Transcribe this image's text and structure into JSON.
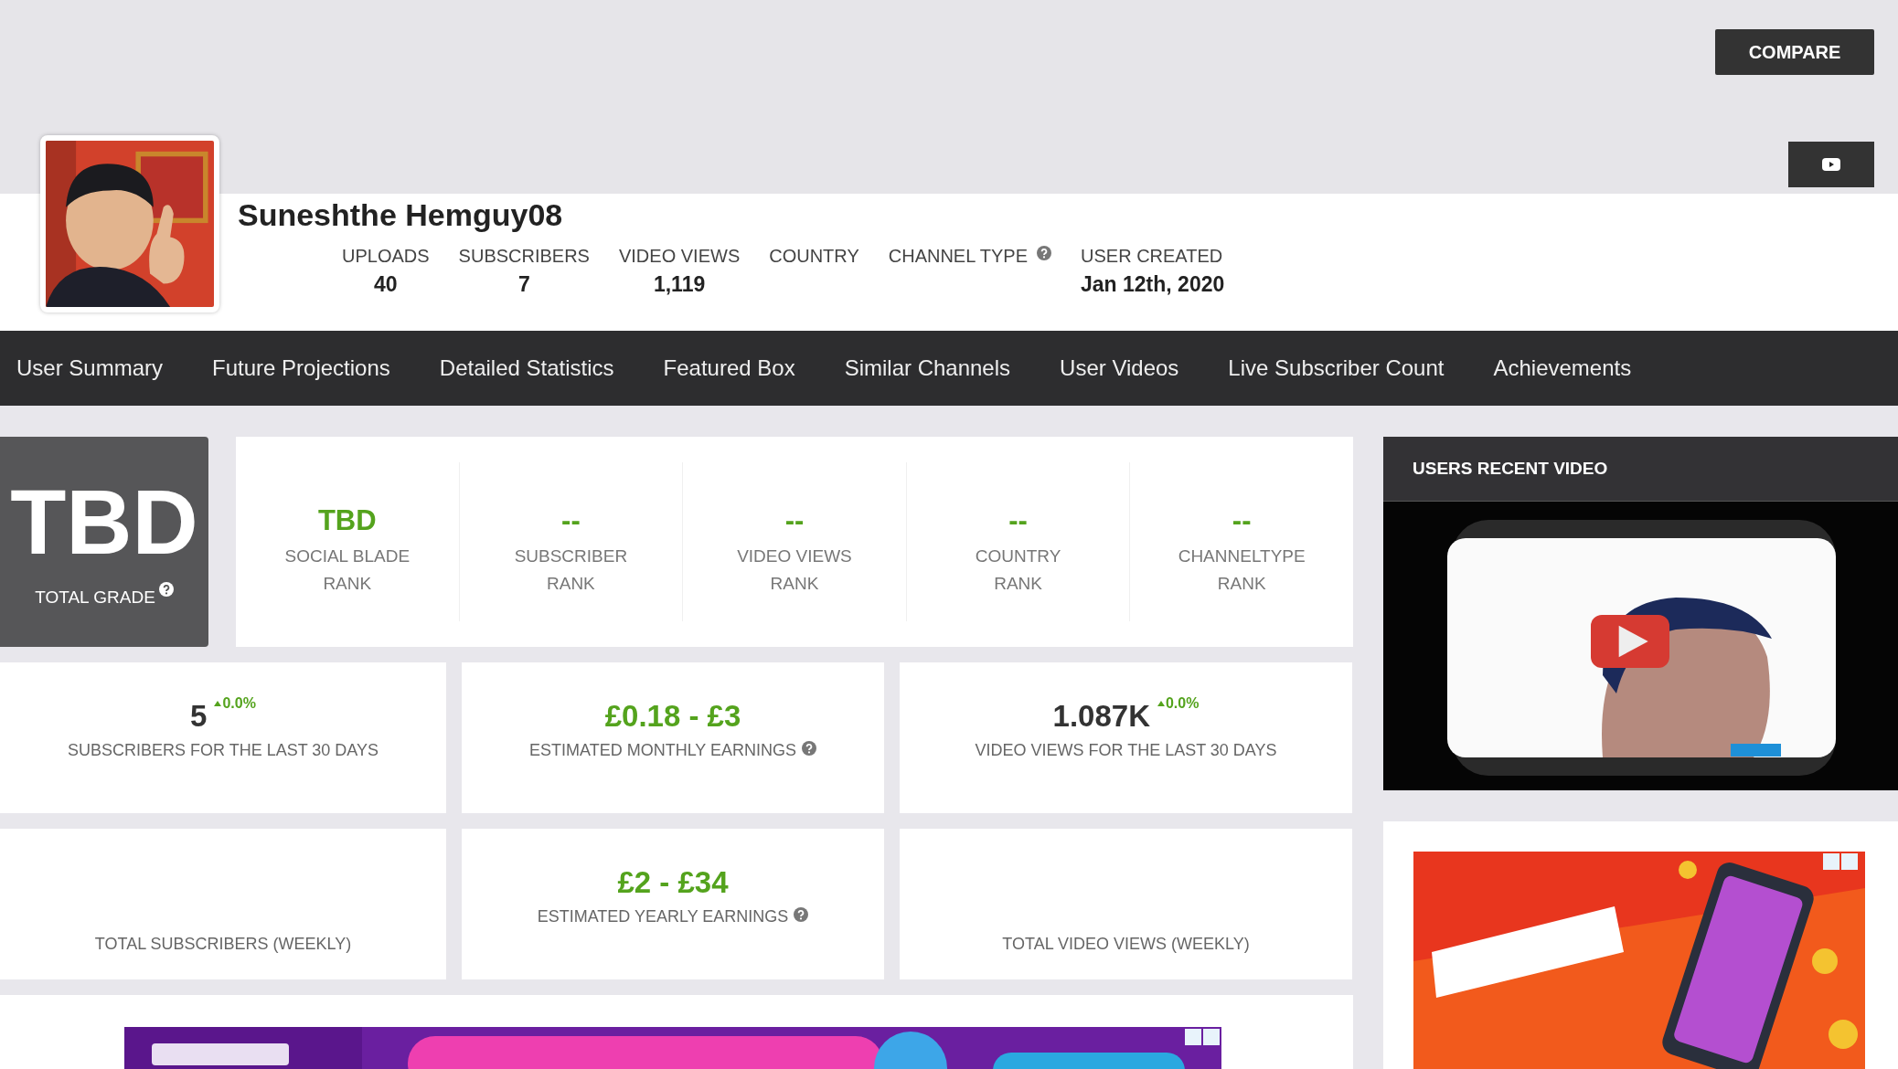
{
  "compare_button": "COMPARE",
  "channel": {
    "name": "Suneshthe Hemguy08",
    "stats": [
      {
        "label": "UPLOADS",
        "value": "40",
        "help": false
      },
      {
        "label": "SUBSCRIBERS",
        "value": "7",
        "help": false
      },
      {
        "label": "VIDEO VIEWS",
        "value": "1,119",
        "help": false
      },
      {
        "label": "COUNTRY",
        "help": false
      },
      {
        "label": "CHANNEL TYPE",
        "help": true
      },
      {
        "label": "USER CREATED",
        "value": "Jan 12th, 2020",
        "help": false
      }
    ]
  },
  "nav": [
    "User Summary",
    "Future Projections",
    "Detailed Statistics",
    "Featured Box",
    "Similar Channels",
    "User Videos",
    "Live Subscriber Count",
    "Achievements"
  ],
  "grade": {
    "value": "TBD",
    "label": "TOTAL GRADE",
    "help": true
  },
  "ranks": [
    {
      "value": "TBD",
      "label_lines": [
        "SOCIAL BLADE",
        "RANK"
      ]
    },
    {
      "value": "--",
      "label_lines": [
        "SUBSCRIBER",
        "RANK"
      ]
    },
    {
      "value": "--",
      "label_lines": [
        "VIDEO VIEWS",
        "RANK"
      ]
    },
    {
      "value": "--",
      "label_lines": [
        "COUNTRY",
        "RANK"
      ]
    },
    {
      "value": "--",
      "label_lines": [
        "CHANNELTYPE",
        "RANK"
      ]
    }
  ],
  "summary": [
    {
      "kind": "count",
      "value": "5",
      "change": "0.0%",
      "label": "SUBSCRIBERS FOR THE LAST 30 DAYS",
      "help": false
    },
    {
      "kind": "earnings",
      "value": "£0.18 - £3",
      "label": "ESTIMATED MONTHLY EARNINGS",
      "help": true
    },
    {
      "kind": "count",
      "value": "1.087K",
      "change": "0.0%",
      "label": "VIDEO VIEWS FOR THE LAST 30 DAYS",
      "help": false
    },
    {
      "kind": "chart",
      "label": "TOTAL SUBSCRIBERS (WEEKLY)",
      "help": false
    },
    {
      "kind": "earnings",
      "value": "£2 - £34",
      "label": "ESTIMATED YEARLY EARNINGS",
      "help": true
    },
    {
      "kind": "chart",
      "label": "TOTAL VIDEO VIEWS (WEEKLY)",
      "help": false
    }
  ],
  "recent_video": {
    "title": "USERS RECENT VIDEO"
  }
}
